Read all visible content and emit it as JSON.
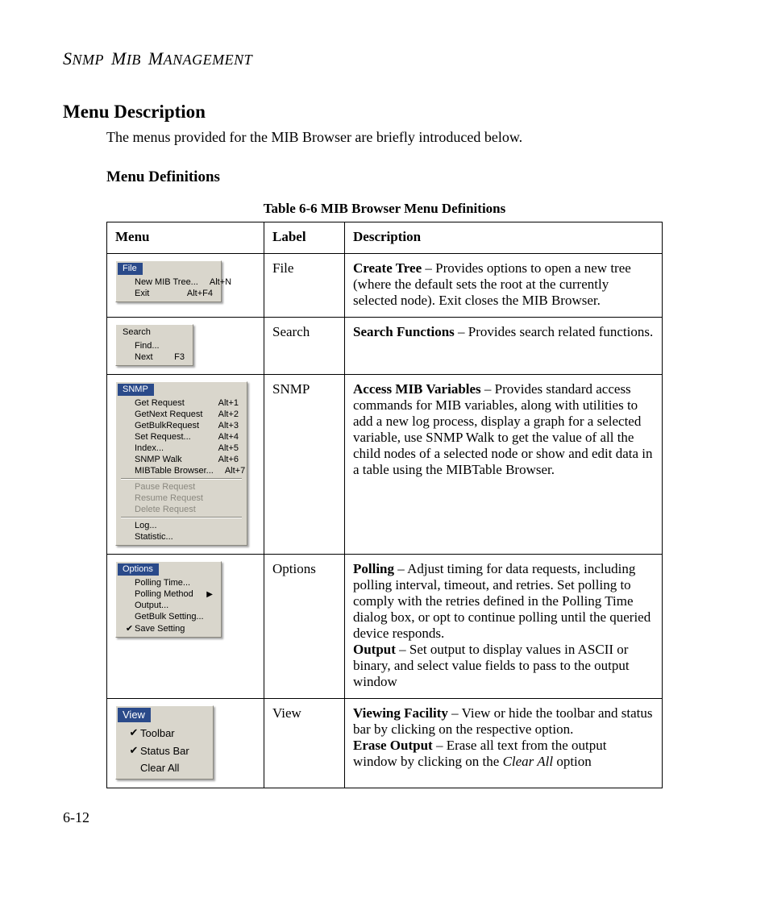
{
  "running_head": "SNMP MIB MANAGEMENT",
  "h2": "Menu Description",
  "lead": "The menus provided for the MIB Browser are briefly introduced below.",
  "h3": "Menu Definitions",
  "table_caption": "Table 6-6  MIB Browser Menu Definitions",
  "table_headers": {
    "c1": "Menu",
    "c2": "Label",
    "c3": "Description"
  },
  "rows": {
    "file": {
      "label": "File",
      "menu_title": "File",
      "menu_items": [
        {
          "label": "New MIB Tree...",
          "accel": "Alt+N"
        },
        {
          "label": "Exit",
          "accel": "Alt+F4"
        }
      ],
      "desc": {
        "b1": "Create Tree",
        "t1": " – Provides options to open a new tree (where the default sets the root at the currently selected node). Exit closes the MIB Browser."
      }
    },
    "search": {
      "label": "Search",
      "menu_title": "Search",
      "menu_items": [
        {
          "label": "Find...",
          "accel": ""
        },
        {
          "label": "Next",
          "accel": "F3"
        }
      ],
      "desc": {
        "b1": "Search Functions",
        "t1": " – Provides search related functions."
      }
    },
    "snmp": {
      "label": "SNMP",
      "menu_title": "SNMP",
      "group1": [
        {
          "label": "Get Request",
          "accel": "Alt+1"
        },
        {
          "label": "GetNext Request",
          "accel": "Alt+2"
        },
        {
          "label": "GetBulkRequest",
          "accel": "Alt+3"
        },
        {
          "label": "Set Request...",
          "accel": "Alt+4"
        },
        {
          "label": "Index...",
          "accel": "Alt+5"
        },
        {
          "label": "SNMP Walk",
          "accel": "Alt+6"
        },
        {
          "label": "MIBTable Browser...",
          "accel": "Alt+7"
        }
      ],
      "group2": [
        {
          "label": "Pause Request"
        },
        {
          "label": "Resume Request"
        },
        {
          "label": "Delete Request"
        }
      ],
      "group3": [
        {
          "label": "Log..."
        },
        {
          "label": "Statistic..."
        }
      ],
      "desc": {
        "b1": "Access MIB Variables",
        "t1": " – Provides standard access commands for MIB variables, along with utilities to add a new log process, display a graph for a selected variable, use SNMP Walk to get the value of all the child nodes of a selected node or show and edit data in a table using the MIBTable Browser."
      }
    },
    "options": {
      "label": "Options",
      "menu_title": "Options",
      "menu_items": [
        {
          "label": "Polling Time...",
          "accel": ""
        },
        {
          "label": "Polling Method",
          "sub": true
        },
        {
          "label": "Output...",
          "accel": ""
        },
        {
          "label": "GetBulk Setting...",
          "accel": ""
        },
        {
          "label": "Save Setting",
          "check": true
        }
      ],
      "desc": {
        "b1": "Polling",
        "t1": " – Adjust timing for data requests, including polling interval, timeout, and retries. Set polling to comply with the retries defined in the Polling Time dialog box, or opt to continue polling until the queried device responds.",
        "b2": "Output",
        "t2": " – Set output to display values in ASCII or binary, and select value fields to pass to the output window"
      }
    },
    "view": {
      "label": "View",
      "menu_title": "View",
      "menu_items": [
        {
          "label": "Toolbar",
          "check": true
        },
        {
          "label": "Status Bar",
          "check": true
        },
        {
          "label": "Clear All",
          "check": false
        }
      ],
      "desc": {
        "b1": "Viewing Facility",
        "t1": " – View or hide the toolbar and status bar by clicking on the respective option.",
        "b2": "Erase Output",
        "t2": " – Erase all text from the output window by clicking on the ",
        "i2": "Clear All",
        "t3": " option"
      }
    }
  },
  "page_number": "6-12"
}
